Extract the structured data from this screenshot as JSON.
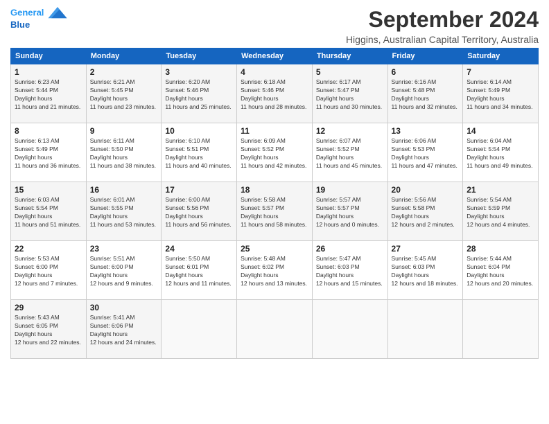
{
  "header": {
    "logo_line1": "General",
    "logo_line2": "Blue",
    "month": "September 2024",
    "location": "Higgins, Australian Capital Territory, Australia"
  },
  "days_of_week": [
    "Sunday",
    "Monday",
    "Tuesday",
    "Wednesday",
    "Thursday",
    "Friday",
    "Saturday"
  ],
  "weeks": [
    [
      {
        "day": 1,
        "sunrise": "6:23 AM",
        "sunset": "5:44 PM",
        "daylight": "11 hours and 21 minutes."
      },
      {
        "day": 2,
        "sunrise": "6:21 AM",
        "sunset": "5:45 PM",
        "daylight": "11 hours and 23 minutes."
      },
      {
        "day": 3,
        "sunrise": "6:20 AM",
        "sunset": "5:46 PM",
        "daylight": "11 hours and 25 minutes."
      },
      {
        "day": 4,
        "sunrise": "6:18 AM",
        "sunset": "5:46 PM",
        "daylight": "11 hours and 28 minutes."
      },
      {
        "day": 5,
        "sunrise": "6:17 AM",
        "sunset": "5:47 PM",
        "daylight": "11 hours and 30 minutes."
      },
      {
        "day": 6,
        "sunrise": "6:16 AM",
        "sunset": "5:48 PM",
        "daylight": "11 hours and 32 minutes."
      },
      {
        "day": 7,
        "sunrise": "6:14 AM",
        "sunset": "5:49 PM",
        "daylight": "11 hours and 34 minutes."
      }
    ],
    [
      {
        "day": 8,
        "sunrise": "6:13 AM",
        "sunset": "5:49 PM",
        "daylight": "11 hours and 36 minutes."
      },
      {
        "day": 9,
        "sunrise": "6:11 AM",
        "sunset": "5:50 PM",
        "daylight": "11 hours and 38 minutes."
      },
      {
        "day": 10,
        "sunrise": "6:10 AM",
        "sunset": "5:51 PM",
        "daylight": "11 hours and 40 minutes."
      },
      {
        "day": 11,
        "sunrise": "6:09 AM",
        "sunset": "5:52 PM",
        "daylight": "11 hours and 42 minutes."
      },
      {
        "day": 12,
        "sunrise": "6:07 AM",
        "sunset": "5:52 PM",
        "daylight": "11 hours and 45 minutes."
      },
      {
        "day": 13,
        "sunrise": "6:06 AM",
        "sunset": "5:53 PM",
        "daylight": "11 hours and 47 minutes."
      },
      {
        "day": 14,
        "sunrise": "6:04 AM",
        "sunset": "5:54 PM",
        "daylight": "11 hours and 49 minutes."
      }
    ],
    [
      {
        "day": 15,
        "sunrise": "6:03 AM",
        "sunset": "5:54 PM",
        "daylight": "11 hours and 51 minutes."
      },
      {
        "day": 16,
        "sunrise": "6:01 AM",
        "sunset": "5:55 PM",
        "daylight": "11 hours and 53 minutes."
      },
      {
        "day": 17,
        "sunrise": "6:00 AM",
        "sunset": "5:56 PM",
        "daylight": "11 hours and 56 minutes."
      },
      {
        "day": 18,
        "sunrise": "5:58 AM",
        "sunset": "5:57 PM",
        "daylight": "11 hours and 58 minutes."
      },
      {
        "day": 19,
        "sunrise": "5:57 AM",
        "sunset": "5:57 PM",
        "daylight": "12 hours and 0 minutes."
      },
      {
        "day": 20,
        "sunrise": "5:56 AM",
        "sunset": "5:58 PM",
        "daylight": "12 hours and 2 minutes."
      },
      {
        "day": 21,
        "sunrise": "5:54 AM",
        "sunset": "5:59 PM",
        "daylight": "12 hours and 4 minutes."
      }
    ],
    [
      {
        "day": 22,
        "sunrise": "5:53 AM",
        "sunset": "6:00 PM",
        "daylight": "12 hours and 7 minutes."
      },
      {
        "day": 23,
        "sunrise": "5:51 AM",
        "sunset": "6:00 PM",
        "daylight": "12 hours and 9 minutes."
      },
      {
        "day": 24,
        "sunrise": "5:50 AM",
        "sunset": "6:01 PM",
        "daylight": "12 hours and 11 minutes."
      },
      {
        "day": 25,
        "sunrise": "5:48 AM",
        "sunset": "6:02 PM",
        "daylight": "12 hours and 13 minutes."
      },
      {
        "day": 26,
        "sunrise": "5:47 AM",
        "sunset": "6:03 PM",
        "daylight": "12 hours and 15 minutes."
      },
      {
        "day": 27,
        "sunrise": "5:45 AM",
        "sunset": "6:03 PM",
        "daylight": "12 hours and 18 minutes."
      },
      {
        "day": 28,
        "sunrise": "5:44 AM",
        "sunset": "6:04 PM",
        "daylight": "12 hours and 20 minutes."
      }
    ],
    [
      {
        "day": 29,
        "sunrise": "5:43 AM",
        "sunset": "6:05 PM",
        "daylight": "12 hours and 22 minutes."
      },
      {
        "day": 30,
        "sunrise": "5:41 AM",
        "sunset": "6:06 PM",
        "daylight": "12 hours and 24 minutes."
      },
      null,
      null,
      null,
      null,
      null
    ]
  ]
}
